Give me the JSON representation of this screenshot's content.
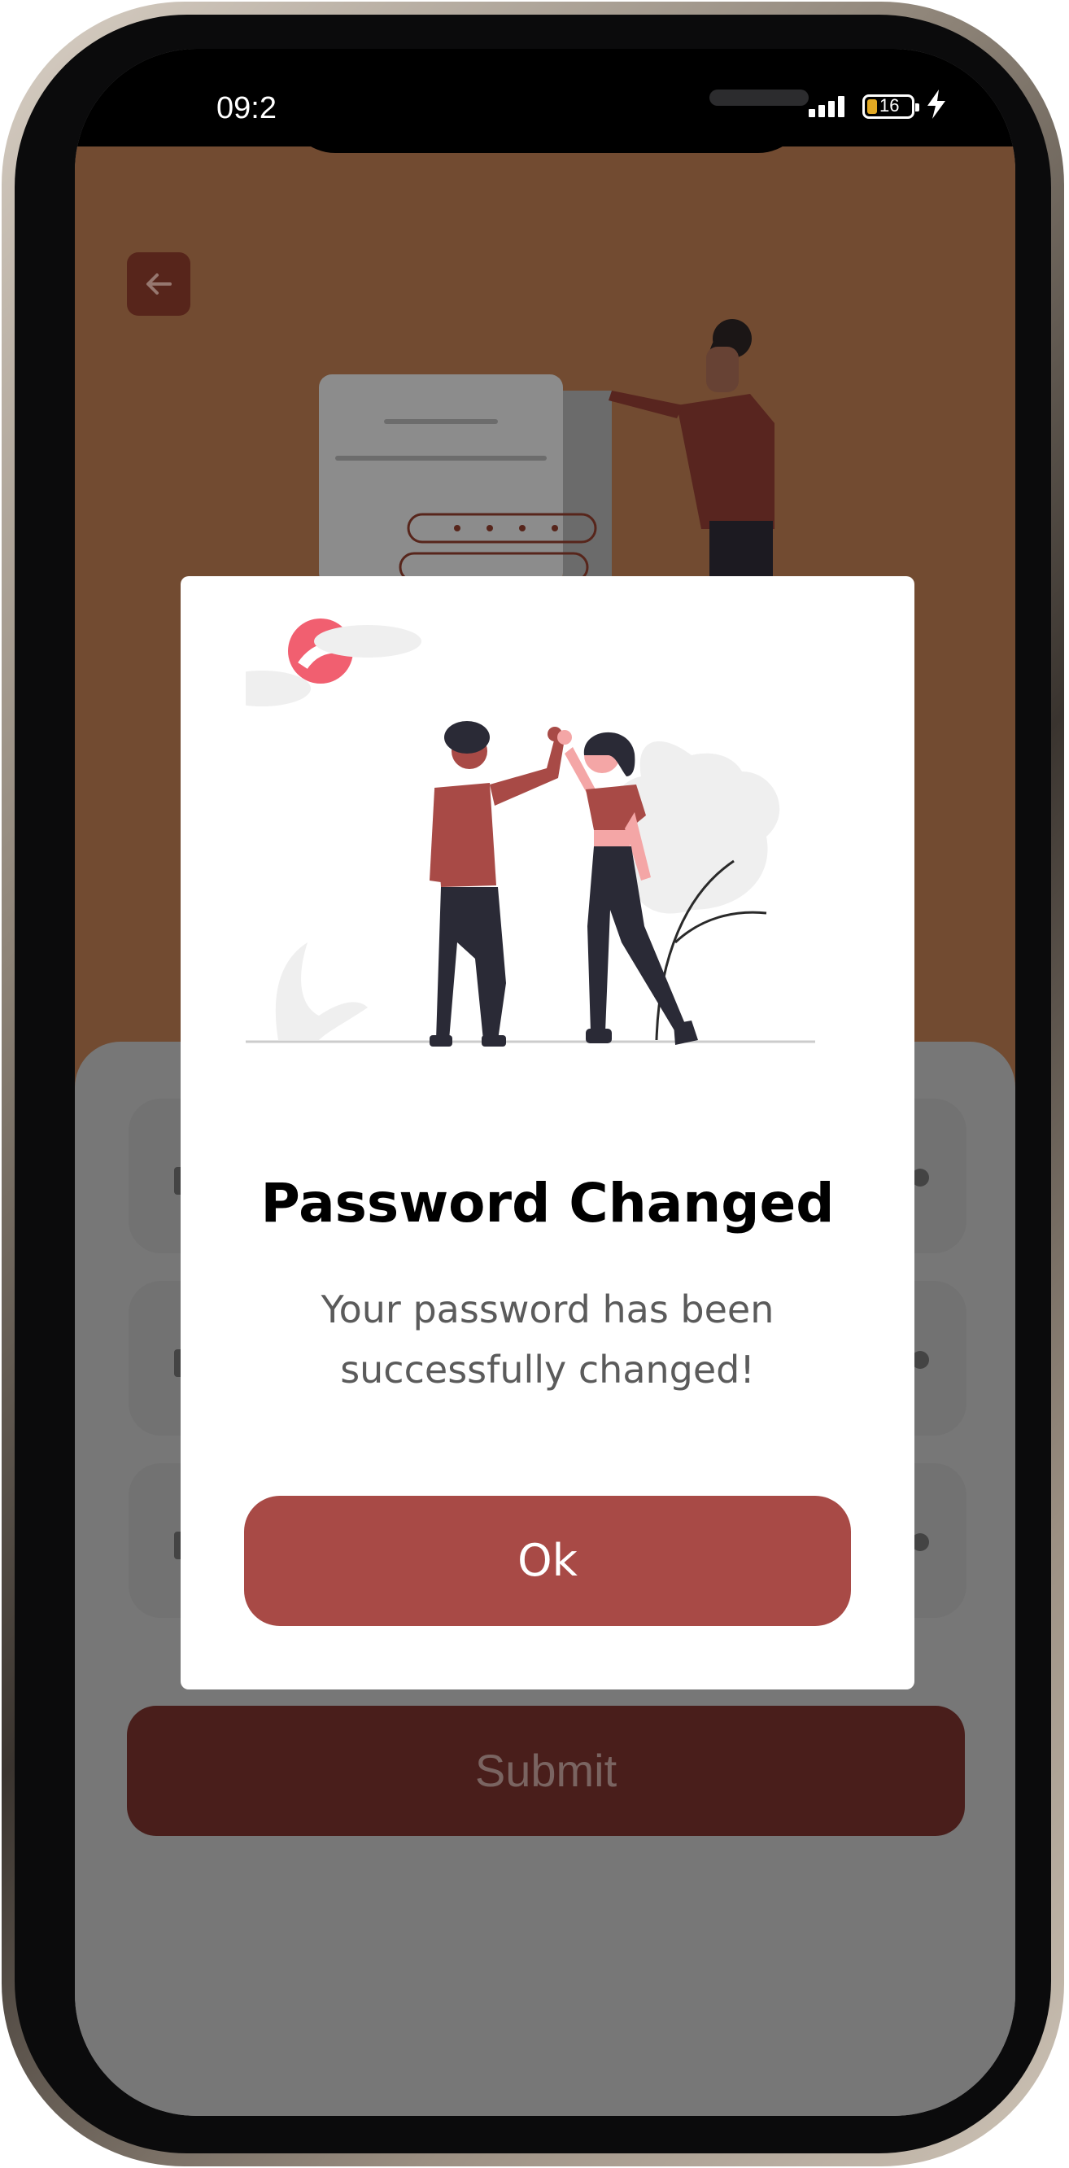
{
  "status_bar": {
    "time": "09:2",
    "battery_level": "16",
    "battery_color": "#e1a823"
  },
  "background_screen": {
    "header_color": "#754d32",
    "back_button_icon": "arrow-left-icon",
    "submit_label": "Submit",
    "fields": [
      {
        "icon_left": "lock-icon",
        "icon_right": "eye-icon"
      },
      {
        "icon_left": "lock-icon",
        "icon_right": "eye-icon"
      },
      {
        "icon_left": "lock-icon",
        "icon_right": "eye-icon"
      }
    ]
  },
  "dialog": {
    "title": "Password Changed",
    "message": "Your password has been successfully changed!",
    "ok_label": "Ok",
    "accent_color": "#a84a46"
  }
}
